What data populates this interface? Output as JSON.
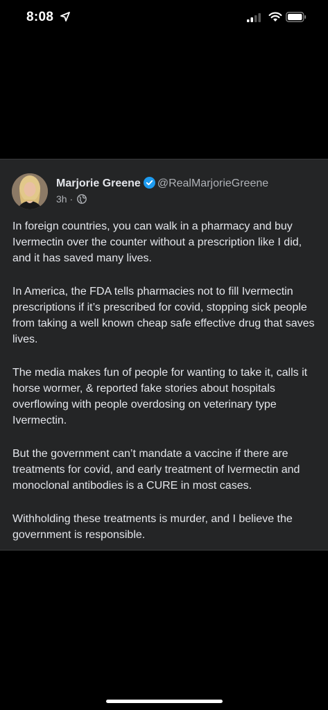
{
  "status_bar": {
    "time": "8:08",
    "icons": [
      "location-arrow-icon",
      "signal-icon",
      "wifi-icon",
      "battery-icon"
    ]
  },
  "post": {
    "author_name": "Marjorie Greene",
    "verified": true,
    "handle": "@RealMarjorieGreene",
    "timestamp": "3h",
    "separator": "·",
    "audience_icon": "globe-icon",
    "paragraphs": [
      "In foreign countries, you can walk in a pharmacy and buy Ivermectin over the counter without a prescription like I did, and it has saved many lives.",
      "In America, the FDA tells pharmacies not to fill Ivermectin prescriptions if it’s prescribed for covid, stopping sick people from taking a well known cheap safe effective drug that saves lives.",
      "The media makes fun of people for wanting to take it, calls it horse wormer, & reported fake stories about hospitals overflowing with people overdosing on veterinary type Ivermectin.",
      "But the government can’t mandate a vaccine if there are treatments for covid, and early treatment of Ivermectin and monoclonal antibodies is a CURE in most cases.",
      "Withholding these treatments is murder, and I believe the government is responsible."
    ]
  },
  "colors": {
    "background": "#000000",
    "card": "#242526",
    "text": "#e4e6eb",
    "muted": "#b0b3b8",
    "verified": "#1d9bf0"
  }
}
